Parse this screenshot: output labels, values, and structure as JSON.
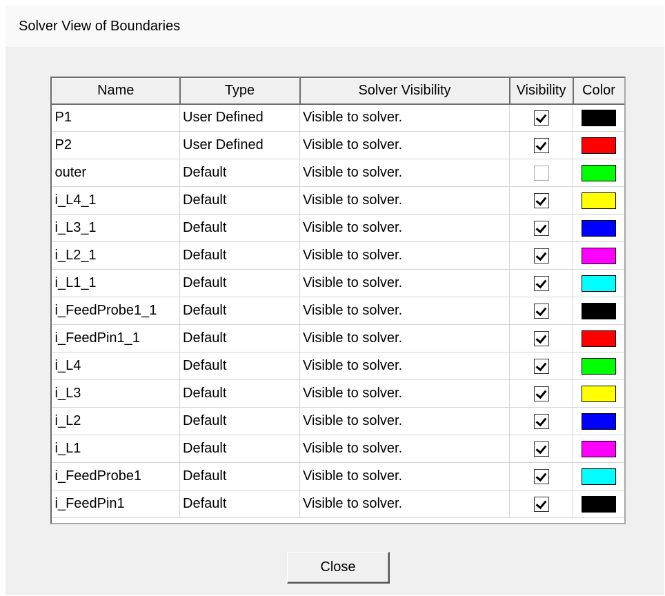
{
  "window": {
    "title": "Solver View of Boundaries"
  },
  "table": {
    "columns": [
      "Name",
      "Type",
      "Solver Visibility",
      "Visibility",
      "Color"
    ],
    "rows": [
      {
        "name": "P1",
        "type": "User Defined",
        "solver_visibility": "Visible to solver.",
        "visible": true,
        "color": "#000000"
      },
      {
        "name": "P2",
        "type": "User Defined",
        "solver_visibility": "Visible to solver.",
        "visible": true,
        "color": "#ff0000"
      },
      {
        "name": "outer",
        "type": "Default",
        "solver_visibility": "Visible to solver.",
        "visible": false,
        "color": "#00ff00"
      },
      {
        "name": "i_L4_1",
        "type": "Default",
        "solver_visibility": "Visible to solver.",
        "visible": true,
        "color": "#ffff00"
      },
      {
        "name": "i_L3_1",
        "type": "Default",
        "solver_visibility": "Visible to solver.",
        "visible": true,
        "color": "#0000ff"
      },
      {
        "name": "i_L2_1",
        "type": "Default",
        "solver_visibility": "Visible to solver.",
        "visible": true,
        "color": "#ff00ff"
      },
      {
        "name": "i_L1_1",
        "type": "Default",
        "solver_visibility": "Visible to solver.",
        "visible": true,
        "color": "#00ffff"
      },
      {
        "name": "i_FeedProbe1_1",
        "type": "Default",
        "solver_visibility": "Visible to solver.",
        "visible": true,
        "color": "#000000"
      },
      {
        "name": "i_FeedPin1_1",
        "type": "Default",
        "solver_visibility": "Visible to solver.",
        "visible": true,
        "color": "#ff0000"
      },
      {
        "name": "i_L4",
        "type": "Default",
        "solver_visibility": "Visible to solver.",
        "visible": true,
        "color": "#00ff00"
      },
      {
        "name": "i_L3",
        "type": "Default",
        "solver_visibility": "Visible to solver.",
        "visible": true,
        "color": "#ffff00"
      },
      {
        "name": "i_L2",
        "type": "Default",
        "solver_visibility": "Visible to solver.",
        "visible": true,
        "color": "#0000ff"
      },
      {
        "name": "i_L1",
        "type": "Default",
        "solver_visibility": "Visible to solver.",
        "visible": true,
        "color": "#ff00ff"
      },
      {
        "name": "i_FeedProbe1",
        "type": "Default",
        "solver_visibility": "Visible to solver.",
        "visible": true,
        "color": "#00ffff"
      },
      {
        "name": "i_FeedPin1",
        "type": "Default",
        "solver_visibility": "Visible to solver.",
        "visible": true,
        "color": "#000000"
      }
    ]
  },
  "buttons": {
    "close_label": "Close"
  }
}
